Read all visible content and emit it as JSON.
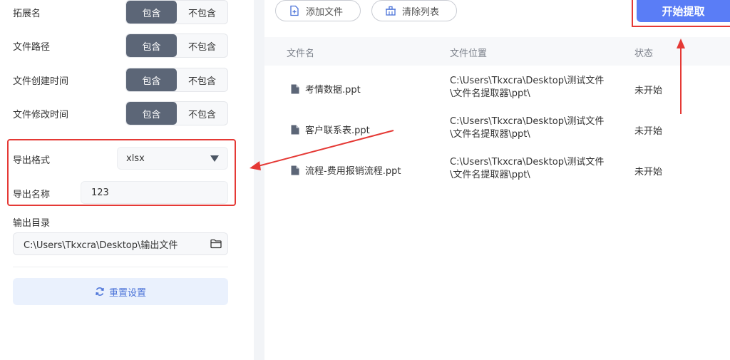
{
  "settings": {
    "rows": [
      {
        "label": "拓展名",
        "include": "包含",
        "exclude": "不包含"
      },
      {
        "label": "文件路径",
        "include": "包含",
        "exclude": "不包含"
      },
      {
        "label": "文件创建时间",
        "include": "包含",
        "exclude": "不包含"
      },
      {
        "label": "文件修改时间",
        "include": "包含",
        "exclude": "不包含"
      }
    ],
    "export_format_label": "导出格式",
    "export_format_value": "xlsx",
    "export_name_label": "导出名称",
    "export_name_value": "123",
    "output_dir_label": "输出目录",
    "output_dir_value": "C:\\Users\\Tkxcra\\Desktop\\输出文件",
    "reset_label": "重置设置"
  },
  "toolbar": {
    "add_file_label": "添加文件",
    "clear_list_label": "清除列表",
    "start_label": "开始提取"
  },
  "table": {
    "headers": {
      "name": "文件名",
      "location": "文件位置",
      "status": "状态"
    },
    "rows": [
      {
        "name": "考情数据.ppt",
        "path_line1": "C:\\Users\\Tkxcra\\Desktop\\测试文件",
        "path_line2": "\\文件名提取器\\ppt\\",
        "status": "未开始"
      },
      {
        "name": "客户联系表.ppt",
        "path_line1": "C:\\Users\\Tkxcra\\Desktop\\测试文件",
        "path_line2": "\\文件名提取器\\ppt\\",
        "status": "未开始"
      },
      {
        "name": "流程-费用报销流程.ppt",
        "path_line1": "C:\\Users\\Tkxcra\\Desktop\\测试文件",
        "path_line2": "\\文件名提取器\\ppt\\",
        "status": "未开始"
      }
    ]
  },
  "colors": {
    "accent": "#5a7df6",
    "segment_active": "#5c6677",
    "annotation_red": "#e53935",
    "reset_text": "#4a72d8"
  },
  "icons": [
    "add-file-icon",
    "clear-list-icon",
    "caret-down-icon",
    "folder-icon",
    "refresh-icon",
    "file-icon"
  ]
}
